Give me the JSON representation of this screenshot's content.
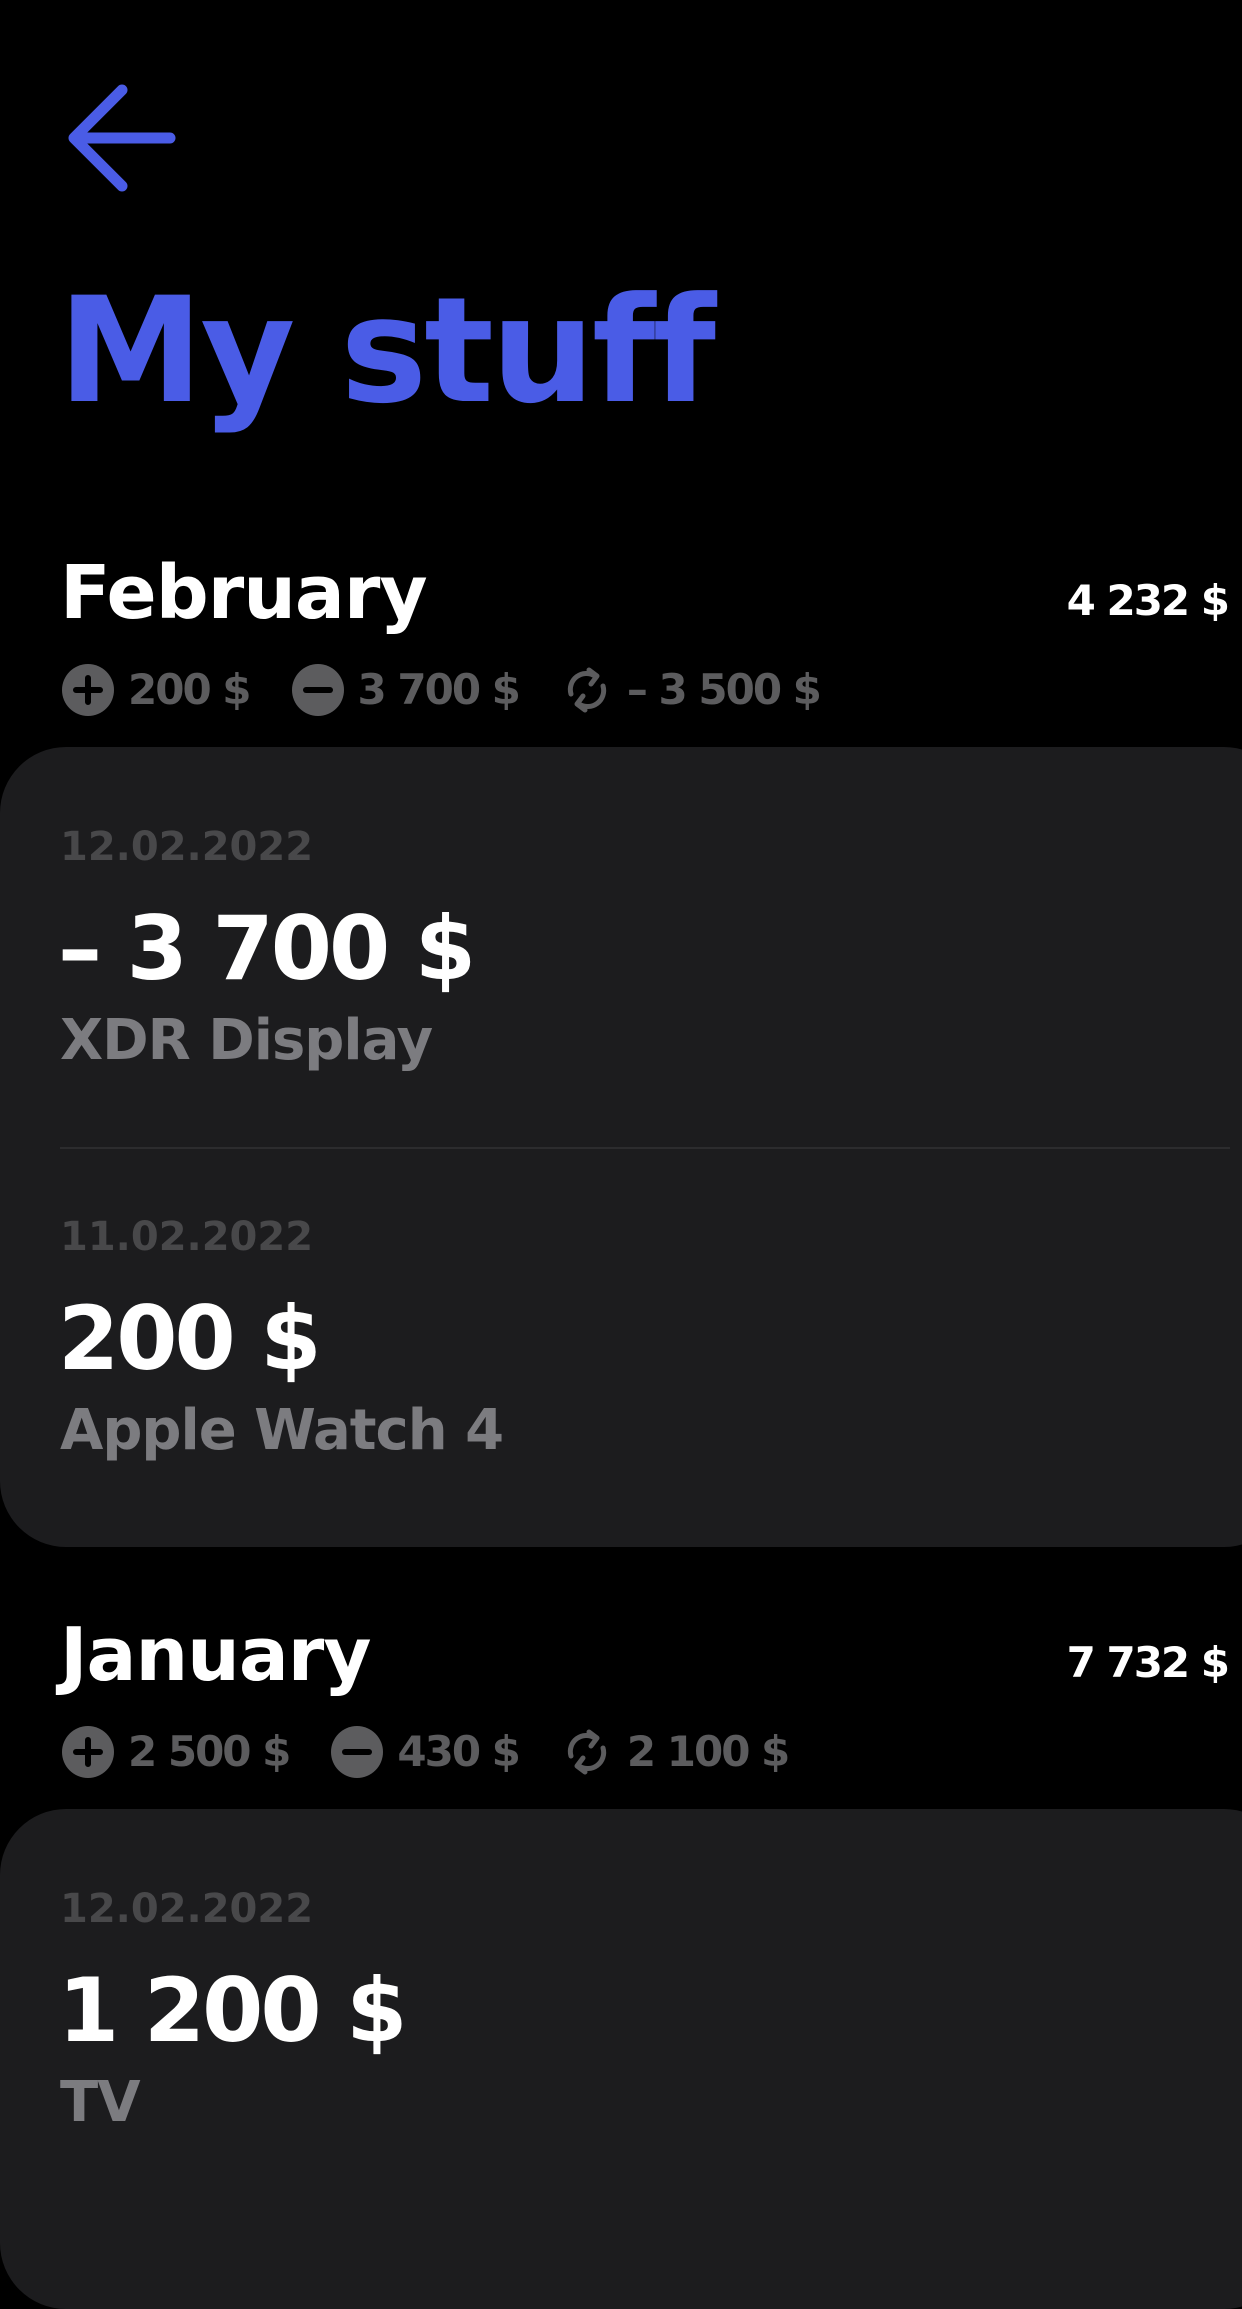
{
  "header": {
    "title": "My stuff",
    "back_icon": "arrow-left-icon",
    "accent_color": "#4a5ce6"
  },
  "months": [
    {
      "name": "February",
      "total": "4 232 $",
      "income": "200 $",
      "expense": "3 700 $",
      "balance": "– 3 500 $",
      "transactions": [
        {
          "date": "12.02.2022",
          "amount": "– 3 700 $",
          "title": "XDR Display"
        },
        {
          "date": "11.02.2022",
          "amount": "200 $",
          "title": "Apple Watch 4"
        }
      ]
    },
    {
      "name": "January",
      "total": "7 732 $",
      "income": "2 500 $",
      "expense": "430 $",
      "balance": "2 100 $",
      "transactions": [
        {
          "date": "12.02.2022",
          "amount": "1 200 $",
          "title": "TV"
        }
      ]
    }
  ],
  "icons": {
    "income": "plus-circle-icon",
    "expense": "minus-circle-icon",
    "balance": "refresh-icon"
  },
  "colors": {
    "background": "#000000",
    "card": "#1c1c1e",
    "muted_text": "#5c5c5e",
    "title_text": "#7c7c80",
    "date_text": "#48484a"
  }
}
